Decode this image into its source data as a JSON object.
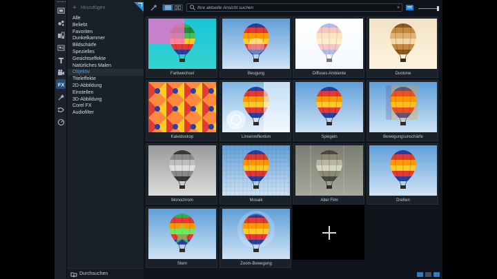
{
  "toolbar": {
    "icons": [
      "media-icon",
      "instant-project-icon",
      "transitions-icon",
      "title-templates-icon",
      "text-icon",
      "video-effects-icon",
      "fx-icon",
      "motion-path-icon",
      "audio-path-icon",
      "speed-icon"
    ]
  },
  "category_panel": {
    "add_label": "Hinzufügen",
    "items": [
      "Alle",
      "Beliebt",
      "Favoriten",
      "Dunkelkammer",
      "Bildschärfe",
      "Spezielles",
      "Gesichtseffekte",
      "Natürliches Malen",
      "Objektiv",
      "Titeleffekte",
      "2D-Abbildung",
      "Einstellen",
      "3D-Abbildung",
      "Corel FX",
      "Audiofilter"
    ],
    "selected": "Objektiv",
    "browse_label": "Durchsuchen"
  },
  "topbar": {
    "search_placeholder": "Ihre aktuelle Ansicht suchen",
    "clear_label": "×"
  },
  "tiles": [
    {
      "name": "Farbwechsel",
      "style": "farb"
    },
    {
      "name": "Beugung",
      "style": "beugung"
    },
    {
      "name": "Diffuses Ambiente",
      "style": "diffus"
    },
    {
      "name": "Duotone",
      "style": "duotone"
    },
    {
      "name": "Kaleidoskop",
      "style": "kaleido"
    },
    {
      "name": "Linsenreflextion",
      "style": "linse"
    },
    {
      "name": "Spiegeln",
      "style": "spiegeln"
    },
    {
      "name": "Bewegungsunschärfe",
      "style": "motionblur"
    },
    {
      "name": "Monochrom",
      "style": "mono"
    },
    {
      "name": "Mosaik",
      "style": "mosaik"
    },
    {
      "name": "Alter Film",
      "style": "alterfilm"
    },
    {
      "name": "Drehen",
      "style": "drehen"
    },
    {
      "name": "Stern",
      "style": "stern"
    },
    {
      "name": "Zoom-Bewegung",
      "style": "zoom"
    }
  ],
  "colors": {
    "accent": "#2a8fd6",
    "selected_text": "#4ea2e8",
    "sky_top": "#5f9fd9",
    "sky_bottom": "#cfe3f5"
  }
}
